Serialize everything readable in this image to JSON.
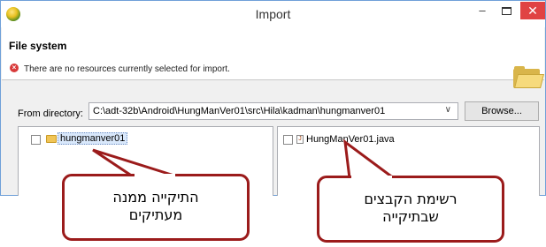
{
  "window": {
    "title": "Import",
    "controls": {
      "minimize": "–",
      "close": "✕"
    }
  },
  "header": {
    "title": "File system",
    "message": "There are no resources currently selected for import.",
    "error_icon": "×",
    "icons": [
      "app-icon",
      "error-icon",
      "folder-wizard-icon"
    ]
  },
  "directory": {
    "label": "From directory:",
    "value": "C:\\adt-32b\\Android\\HungManVer01\\src\\Hila\\kadman\\hungmanver01",
    "dropdown_arrow": "∨",
    "browse_label": "Browse..."
  },
  "left_panel": {
    "items": [
      {
        "label": "hungmanver01",
        "icon": "folder-icon",
        "checked": false
      }
    ]
  },
  "right_panel": {
    "items": [
      {
        "label": "HungManVer01.java",
        "icon": "java-file-icon",
        "java_glyph": "J",
        "checked": false
      }
    ]
  },
  "callouts": {
    "left": {
      "line1": "התיקייה ממנה",
      "line2": "מעתיקים"
    },
    "right": {
      "line1": "רשימת הקבצים",
      "line2": "שבתיקייה"
    },
    "border_color": "#9b1b1b"
  }
}
